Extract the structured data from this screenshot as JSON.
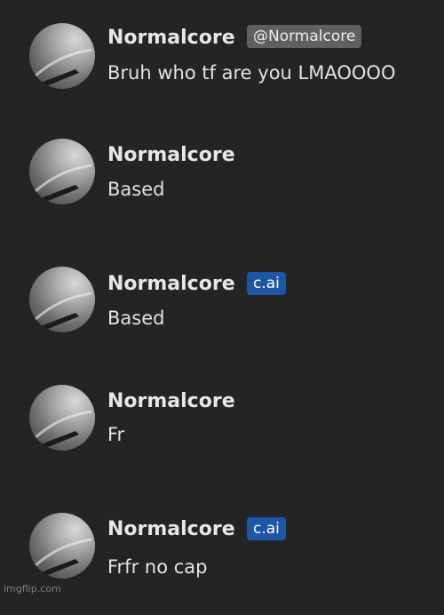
{
  "messages": [
    {
      "author": "Normalcore",
      "badge": "@Normalcore",
      "badge_type": "handle",
      "text": "Bruh who tf are you LMAOOOO",
      "avatar_icon": "gray-swirl-avatar"
    },
    {
      "author": "Normalcore",
      "badge": "",
      "badge_type": "none",
      "text": "Based",
      "avatar_icon": "gray-swirl-avatar"
    },
    {
      "author": "Normalcore",
      "badge": "c.ai",
      "badge_type": "cai",
      "text": "Based",
      "avatar_icon": "gray-swirl-avatar"
    },
    {
      "author": "Normalcore",
      "badge": "",
      "badge_type": "none",
      "text": "Fr",
      "avatar_icon": "gray-swirl-avatar"
    },
    {
      "author": "Normalcore",
      "badge": "c.ai",
      "badge_type": "cai",
      "text": "Frfr no cap",
      "avatar_icon": "gray-swirl-avatar"
    }
  ],
  "watermark": "imgflip.com",
  "colors": {
    "background": "#232425",
    "handle_badge": "#5f6062",
    "cai_badge": "#1e55a5"
  }
}
